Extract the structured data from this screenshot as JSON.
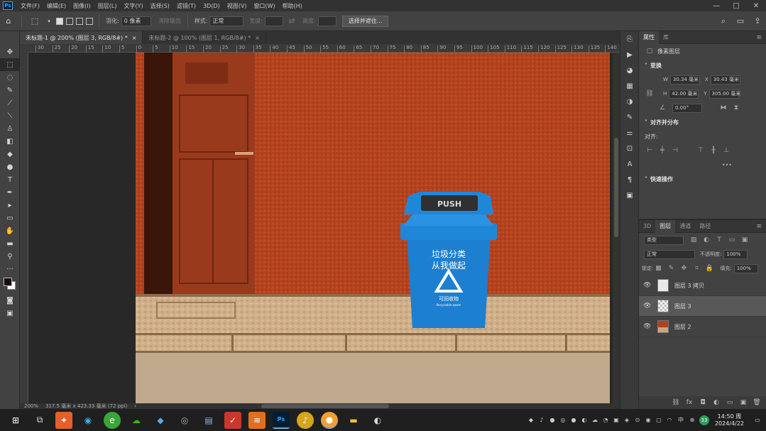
{
  "app": {
    "logo": "Ps"
  },
  "menu": [
    "文件(F)",
    "编辑(E)",
    "图像(I)",
    "图层(L)",
    "文字(Y)",
    "选择(S)",
    "滤镜(T)",
    "3D(D)",
    "视图(V)",
    "窗口(W)",
    "帮助(H)"
  ],
  "window_controls": [
    "—",
    "□",
    "✕"
  ],
  "options": {
    "feather_label": "羽化:",
    "feather_value": "0 像素",
    "antialias_label": "消除锯齿",
    "style_label": "样式:",
    "style_value": "正常",
    "width_label": "宽度:",
    "height_label": "高度:",
    "select_mask_button": "选择并遮住..."
  },
  "tabs": [
    {
      "label": "未标题-1 @ 200% (图层 3, RGB/8#) *",
      "close": "×"
    },
    {
      "label": "未标题-2 @ 100% (图层 1, RGB/8#) *",
      "close": "×"
    }
  ],
  "ruler_ticks": [
    "30",
    "25",
    "20",
    "15",
    "10",
    "5",
    "0",
    "5",
    "10",
    "15",
    "20",
    "25",
    "30",
    "35",
    "40",
    "45",
    "50",
    "55",
    "60",
    "65",
    "70",
    "75",
    "80",
    "85",
    "90",
    "95",
    "100",
    "105",
    "110",
    "115",
    "120",
    "125",
    "130",
    "135",
    "140"
  ],
  "status": {
    "zoom": "200%",
    "doc_size": "317.5 毫米 x 423.33 毫米 (72 ppi)",
    "arrow": "›"
  },
  "canvas_art": {
    "bin_lid_text": "PUSH",
    "bin_line1": "垃圾分类",
    "bin_line2": "从我做起",
    "bin_label": "可回收物",
    "bin_label_en": "Recyclable waste",
    "wall_color": "#b5421f",
    "bin_color": "#1d7fd0"
  },
  "properties": {
    "tabs": [
      "属性",
      "库"
    ],
    "layer_type": "像素图层",
    "transform_label": "变换",
    "w_label": "W",
    "w_value": "30.34 毫米",
    "x_label": "X",
    "x_value": "30.43 毫米",
    "h_label": "H",
    "h_value": "42.00 毫米",
    "y_label": "Y",
    "y_value": "305.00 毫米",
    "angle_value": "0.00°",
    "align_label": "对齐并分布",
    "align_sub": "对齐:",
    "more": "•••",
    "quick_label": "快速操作"
  },
  "layers_panel": {
    "tabs": [
      "3D",
      "图层",
      "通道",
      "路径"
    ],
    "filter_label": "类型",
    "blend_mode": "正常",
    "opacity_label": "不透明度:",
    "opacity_value": "100%",
    "lock_label": "锁定:",
    "fill_label": "填充:",
    "fill_value": "100%",
    "layers": [
      {
        "name": "图层 3 拷贝"
      },
      {
        "name": "图层 3"
      },
      {
        "name": "图层 2"
      }
    ],
    "footer_icons": [
      "⛓",
      "fx",
      "◘",
      "◐",
      "▭",
      "▣",
      "🗑"
    ]
  },
  "taskbar": {
    "time": "14:50 周",
    "date": "2024/4/22",
    "ime": "中",
    "badge": "33"
  }
}
